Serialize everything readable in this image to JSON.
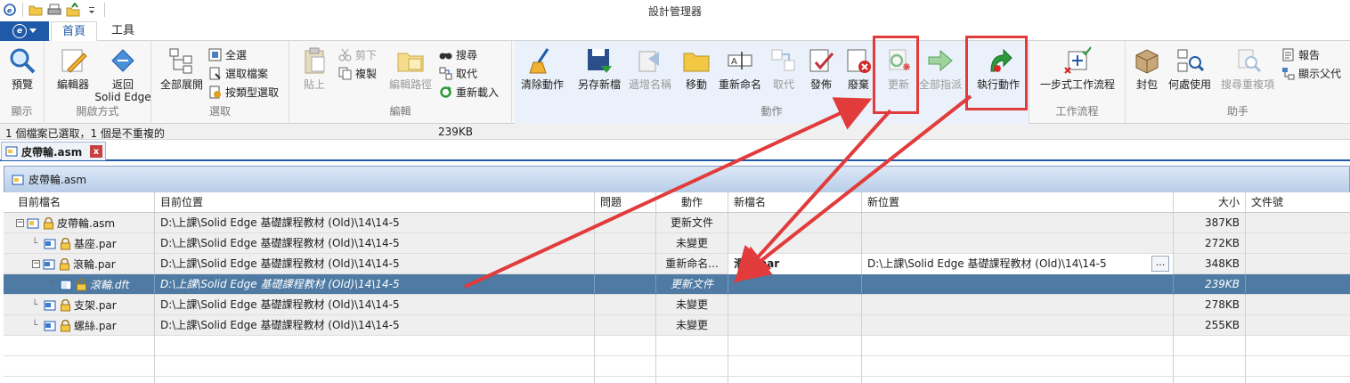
{
  "window": {
    "title": "設計管理器"
  },
  "tabs": [
    {
      "label": "首頁"
    },
    {
      "label": "工具"
    }
  ],
  "ribbon": {
    "groups": {
      "display": "顯示",
      "open_method": "開啟方式",
      "select": "選取",
      "edit": "編輯",
      "action": "動作",
      "workflow": "工作流程",
      "assistant": "助手"
    },
    "buttons": {
      "preview": "預覽",
      "editor": "編輯器",
      "return_line1": "返回",
      "return_line2": "Solid Edge",
      "expand_all": "全部展開",
      "select_all": "全選",
      "select_files": "選取檔案",
      "select_by_type": "按類型選取",
      "paste": "貼上",
      "cut": "剪下",
      "copy": "複製",
      "edit_path": "編輯路徑",
      "search": "搜尋",
      "replace": "取代",
      "reload": "重新載入",
      "clear_action": "清除動作",
      "save_as_new": "另存新檔",
      "increment_name": "遞增名稱",
      "move": "移動",
      "rename": "重新命名",
      "replace2": "取代",
      "publish": "發佈",
      "obsolete": "廢棄",
      "update": "更新",
      "all_points": "全部指派",
      "perform_action": "執行動作",
      "one_step_workflow": "一步式工作流程",
      "pack": "封包",
      "where_used": "何處使用",
      "search_duplicates": "搜尋重複項",
      "report": "報告",
      "show_parent": "顯示父代"
    }
  },
  "status": {
    "selection": "1 個檔案已選取，1 個是不重複的",
    "size": "239KB"
  },
  "doc_tab": {
    "label": "皮帶輪.asm",
    "close": "x"
  },
  "panel": {
    "title": "皮帶輪.asm"
  },
  "grid": {
    "headers": {
      "current_name": "目前檔名",
      "current_location": "目前位置",
      "issue": "問題",
      "action": "動作",
      "new_name": "新檔名",
      "new_location": "新位置",
      "size": "大小",
      "doc_number": "文件號"
    },
    "rows": [
      {
        "name": "皮帶輪.asm",
        "location": "D:\\上課\\Solid Edge 基礎課程教材 (Old)\\14\\14-5",
        "action": "更新文件",
        "new_name": "",
        "new_location": "",
        "size": "387KB"
      },
      {
        "name": "基座.par",
        "location": "D:\\上課\\Solid Edge 基礎課程教材 (Old)\\14\\14-5",
        "action": "未變更",
        "new_name": "",
        "new_location": "",
        "size": "272KB"
      },
      {
        "name": "滾輪.par",
        "location": "D:\\上課\\Solid Edge 基礎課程教材 (Old)\\14\\14-5",
        "action": "重新命名...",
        "new_name": "滑輪.par",
        "new_location": "D:\\上課\\Solid Edge 基礎課程教材 (Old)\\14\\14-5",
        "browse": "...",
        "size": "348KB"
      },
      {
        "name": "滾輪.dft",
        "location": "D:\\上課\\Solid Edge 基礎課程教材 (Old)\\14\\14-5",
        "action": "更新文件",
        "new_name": "",
        "new_location": "",
        "size": "239KB"
      },
      {
        "name": "支架.par",
        "location": "D:\\上課\\Solid Edge 基礎課程教材 (Old)\\14\\14-5",
        "action": "未變更",
        "new_name": "",
        "new_location": "",
        "size": "278KB"
      },
      {
        "name": "螺絲.par",
        "location": "D:\\上課\\Solid Edge 基礎課程教材 (Old)\\14\\14-5",
        "action": "未變更",
        "new_name": "",
        "new_location": "",
        "size": "255KB"
      }
    ]
  },
  "colors": {
    "accent": "#1f5aa8",
    "selected_row": "#4e7aa3",
    "annotation": "#e23b3b"
  }
}
